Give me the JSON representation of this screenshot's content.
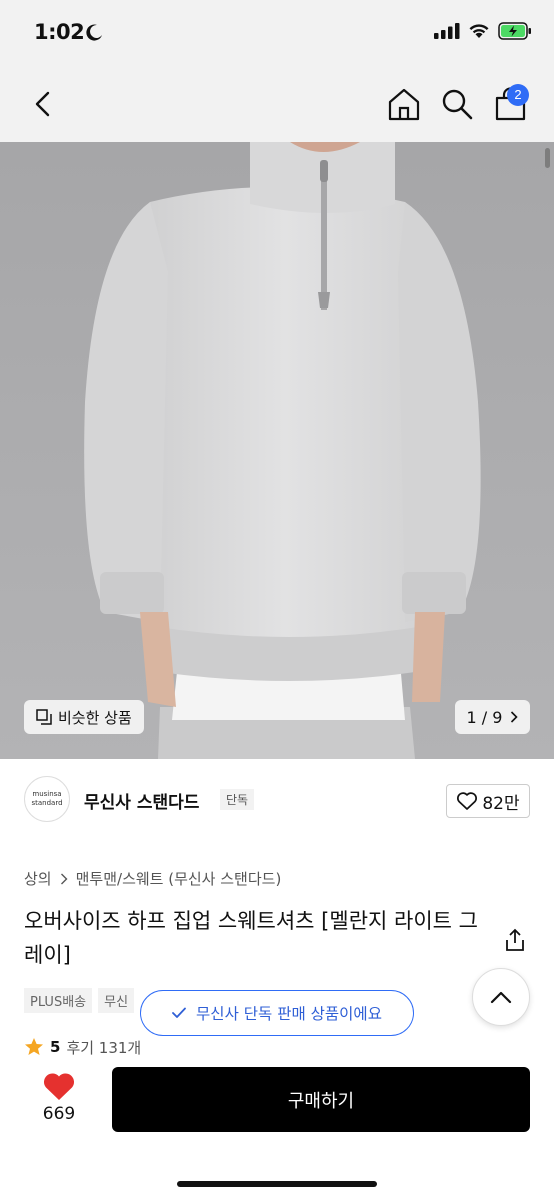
{
  "status": {
    "time": "1:02"
  },
  "header": {
    "cart_count": "2"
  },
  "hero": {
    "similar_label": "비슷한 상품",
    "page_indicator": "1 / 9"
  },
  "brand": {
    "logo_line1": "musinsa",
    "logo_line2": "standard",
    "name": "무신사 스탠다드",
    "badge": "단독",
    "likes": "82만"
  },
  "breadcrumb": {
    "level1": "상의",
    "level2": "맨투맨/스웨트 (무신사 스탠다드)"
  },
  "product": {
    "title": "오버사이즈 하프 집업 스웨트셔츠 [멜란지 라이트 그레이]"
  },
  "tags": [
    "PLUS배송",
    "무신"
  ],
  "rating": {
    "score": "5",
    "reviews": "후기 131개"
  },
  "toast": {
    "text": "무신사 단독 판매 상품이에요"
  },
  "bottom": {
    "heart_count": "669",
    "buy_label": "구매하기"
  },
  "colors": {
    "accent_blue": "#2f6cf6",
    "heart_red": "#e5312f",
    "buy_bg": "#000000",
    "star": "#f5a623"
  }
}
